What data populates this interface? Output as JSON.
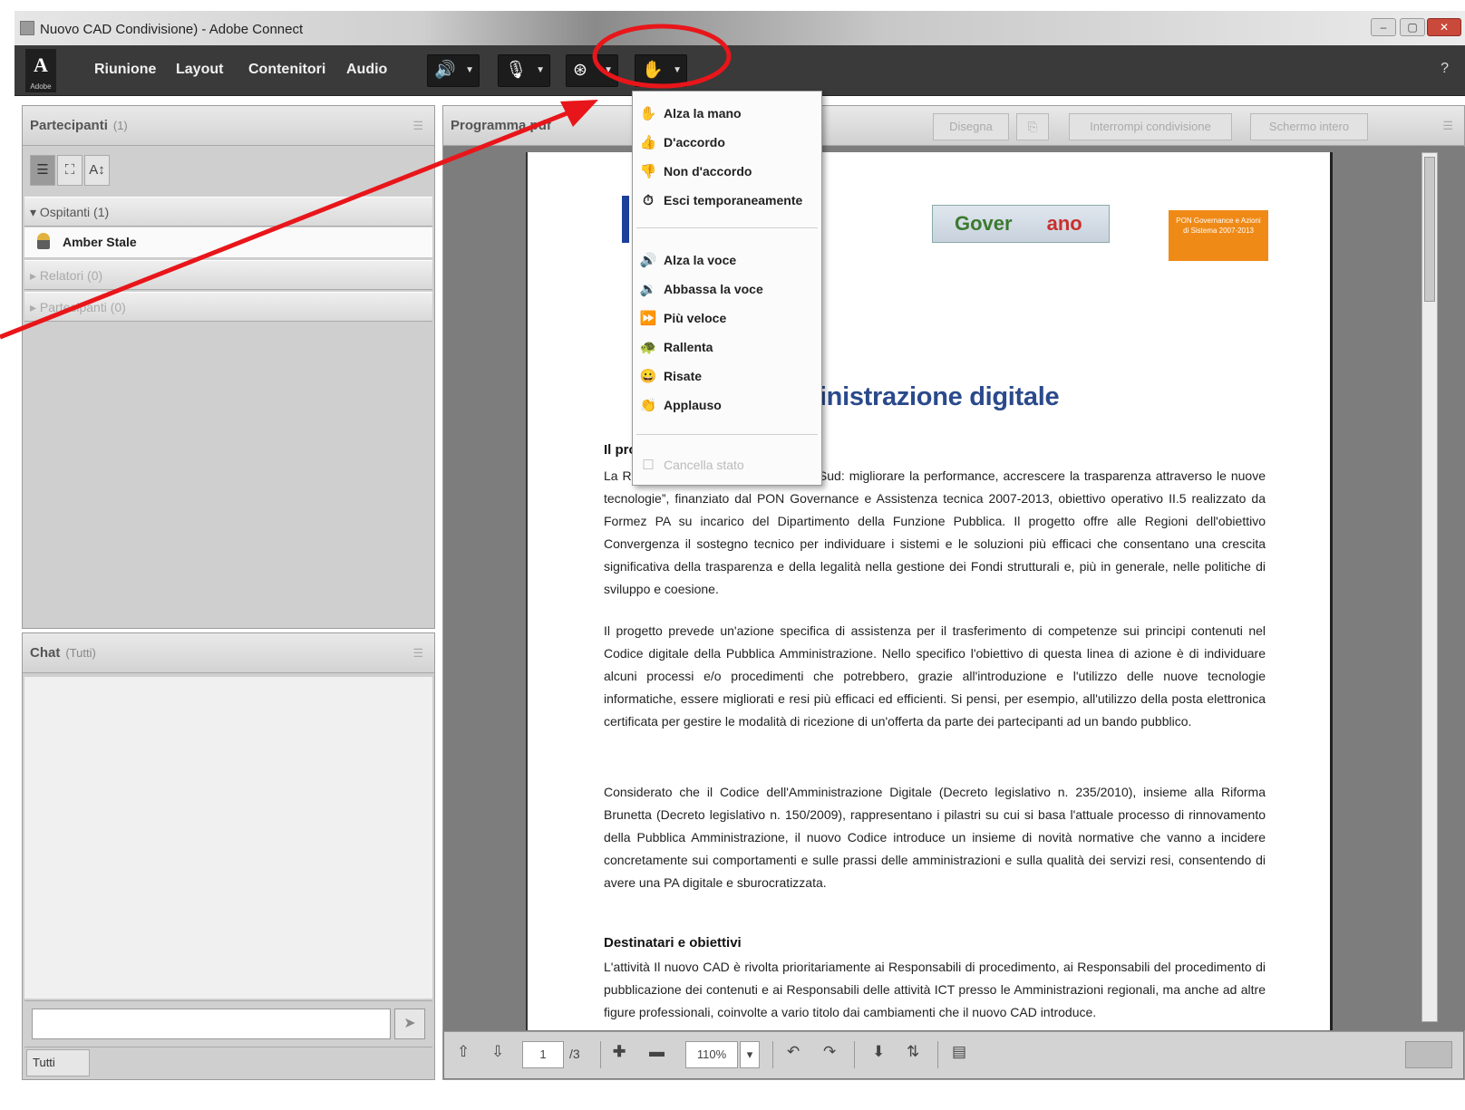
{
  "window": {
    "title": "Nuovo CAD Condivisione) - Adobe Connect",
    "min": "–",
    "max": "▢",
    "close": "✕"
  },
  "toolbar": {
    "logo": "A",
    "logo_sub": "Adobe",
    "menus": [
      "Riunione",
      "Layout",
      "Contenitori",
      "Audio"
    ],
    "help": "?"
  },
  "participants": {
    "title": "Partecipanti",
    "count": "(1)",
    "tools": [
      "☰",
      "⛶",
      "A↕"
    ],
    "groups": [
      {
        "label": "▾ Ospitanti (1)"
      },
      {
        "label": "▸ Relatori (0)"
      },
      {
        "label": "▸ Partecipanti (0)"
      }
    ],
    "host_name": "Amber Stale"
  },
  "chat": {
    "title": "Chat",
    "count": "(Tutti)",
    "input_placeholder": "",
    "to": "Tutti"
  },
  "share": {
    "title": "Programma.pdf",
    "buttons": [
      "Disegna",
      "⎘",
      "Interrompi condivisione",
      "Schermo intero"
    ],
    "footer": {
      "page": "1",
      "of": "/3",
      "zoom": "110%"
    }
  },
  "document": {
    "logo1": "Gover",
    "logo1b": "ano",
    "logo2": "PON Governance e Azioni di Sistema 2007-2013",
    "heading": "lice dell'Amministrazione digitale",
    "para1_lead": "Il pro",
    "para1": "La R… progetto “ETICA pubblica nel Sud: migliorare la performance, accrescere la trasparenza attraverso le nuove tecnologie”, finanziato dal PON Governance e Assistenza tecnica 2007-2013, obiettivo operativo II.5 realizzato da Formez PA su incarico del Dipartimento della Funzione Pubblica. Il progetto offre alle Regioni dell'obiettivo Convergenza il sostegno tecnico per individuare i sistemi e le soluzioni più efficaci che consentano una crescita significativa della trasparenza e della legalità nella gestione dei Fondi strutturali e, più in generale, nelle politiche di sviluppo e coesione.",
    "para2": "Il progetto prevede un'azione specifica di assistenza per il trasferimento di competenze sui principi contenuti nel Codice digitale della Pubblica Amministrazione. Nello specifico l'obiettivo di questa linea di azione è di individuare alcuni processi e/o procedimenti che potrebbero, grazie all'introduzione e l'utilizzo delle nuove tecnologie informatiche, essere migliorati e resi più efficaci ed efficienti. Si pensi, per esempio, all'utilizzo della posta elettronica certificata per gestire le modalità di ricezione di un'offerta da parte dei partecipanti ad un bando pubblico.",
    "para3": "Considerato che il Codice dell'Amministrazione Digitale (Decreto legislativo n. 235/2010), insieme alla Riforma Brunetta (Decreto legislativo n. 150/2009), rappresentano i pilastri su cui si basa l'attuale processo di rinnovamento della Pubblica Amministrazione, il nuovo Codice introduce un insieme di novità normative che vanno a incidere concretamente sui comportamenti e sulle prassi delle amministrazioni e sulla qualità dei servizi resi, consentendo di avere una PA digitale e sburocratizzata.",
    "sub": "Destinatari e obiettivi",
    "para4": "L'attività Il nuovo CAD è rivolta prioritariamente ai Responsabili di procedimento, ai Responsabili del procedimento di pubblicazione dei contenuti e ai Responsabili delle attività ICT presso le Amministrazioni regionali, ma anche ad altre figure professionali, coinvolte a vario titolo dai cambiamenti che il nuovo CAD introduce."
  },
  "status_menu": {
    "items": [
      {
        "icon": "✋",
        "label": "Alza la mano"
      },
      {
        "icon": "👍",
        "label": "D'accordo"
      },
      {
        "icon": "👎",
        "label": "Non d'accordo"
      },
      {
        "icon": "⏱",
        "label": "Esci temporaneamente"
      },
      {
        "icon": "🔊",
        "label": "Alza la voce"
      },
      {
        "icon": "🔉",
        "label": "Abbassa la voce"
      },
      {
        "icon": "⏩",
        "label": "Più veloce"
      },
      {
        "icon": "🐢",
        "label": "Rallenta"
      },
      {
        "icon": "😀",
        "label": "Risate"
      },
      {
        "icon": "👏",
        "label": "Applauso"
      },
      {
        "icon": "☐",
        "label": "Cancella stato"
      }
    ]
  },
  "colors": {
    "annotation": "#e8161a",
    "toolbar": "#3a3a3a",
    "heading": "#2b4a8c"
  }
}
